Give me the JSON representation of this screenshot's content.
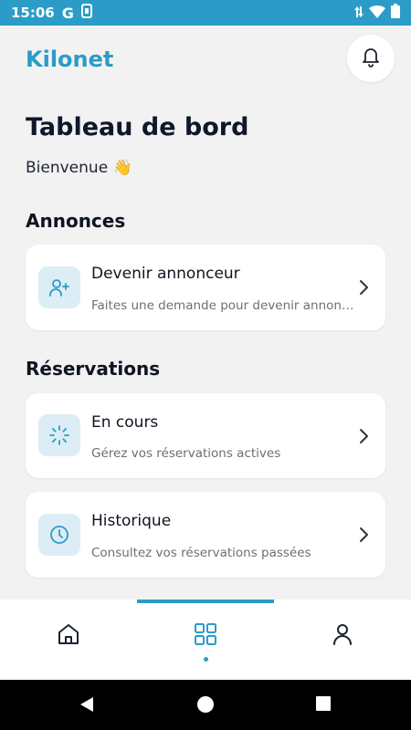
{
  "status_bar": {
    "time": "15:06",
    "g_label": "G"
  },
  "header": {
    "brand": "Kilonet"
  },
  "page": {
    "title": "Tableau de bord",
    "welcome": "Bienvenue 👋"
  },
  "sections": {
    "annonces": {
      "title": "Annonces",
      "cards": [
        {
          "title": "Devenir annonceur",
          "subtitle": "Faites une demande pour devenir annonceur"
        }
      ]
    },
    "reservations": {
      "title": "Réservations",
      "cards": [
        {
          "title": "En cours",
          "subtitle": "Gérez vos réservations actives"
        },
        {
          "title": "Historique",
          "subtitle": "Consultez vos réservations passées"
        }
      ]
    }
  },
  "icons": {
    "notifications": "bell-icon",
    "become_advertiser": "user-plus-icon",
    "in_progress": "loader-icon",
    "history": "clock-icon",
    "nav_home": "home-icon",
    "nav_dashboard": "grid-icon",
    "nav_profile": "user-icon"
  },
  "bottom_nav": {
    "active_index": 1
  },
  "colors": {
    "accent": "#2a9cc7",
    "background": "#f2f2f2",
    "card": "#ffffff",
    "icon_tile": "#dcedf6"
  }
}
